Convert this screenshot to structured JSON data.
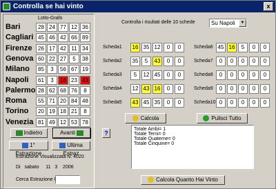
{
  "window": {
    "title": "Controlla se hai vinto",
    "close": "x"
  },
  "lotto": {
    "header": "Lotto-Grafo",
    "rows": [
      {
        "name": "Bari",
        "nums": [
          "28",
          "24",
          "77",
          "12",
          "36"
        ],
        "red": [
          false,
          false,
          false,
          false,
          false
        ]
      },
      {
        "name": "Cagliari",
        "nums": [
          "45",
          "46",
          "42",
          "66",
          "89"
        ],
        "red": [
          false,
          false,
          false,
          false,
          false
        ]
      },
      {
        "name": "Firenze",
        "nums": [
          "26",
          "17",
          "42",
          "11",
          "34"
        ],
        "red": [
          false,
          false,
          false,
          false,
          false
        ]
      },
      {
        "name": "Genova",
        "nums": [
          "60",
          "22",
          "27",
          "5",
          "38"
        ],
        "red": [
          false,
          false,
          false,
          false,
          false
        ]
      },
      {
        "name": "Milano",
        "nums": [
          "85",
          "3",
          "56",
          "67",
          "19"
        ],
        "red": [
          false,
          false,
          false,
          false,
          false
        ]
      },
      {
        "name": "Napoli",
        "nums": [
          "61",
          "3",
          "16",
          "23",
          "43"
        ],
        "red": [
          false,
          false,
          true,
          false,
          true
        ]
      },
      {
        "name": "Palermo",
        "nums": [
          "28",
          "62",
          "68",
          "76",
          "8"
        ],
        "red": [
          false,
          false,
          false,
          false,
          false
        ]
      },
      {
        "name": "Roma",
        "nums": [
          "55",
          "71",
          "20",
          "84",
          "48"
        ],
        "red": [
          false,
          false,
          false,
          false,
          false
        ]
      },
      {
        "name": "Torino",
        "nums": [
          "20",
          "19",
          "18",
          "21",
          "8"
        ],
        "red": [
          false,
          false,
          false,
          false,
          false
        ]
      },
      {
        "name": "Venezia",
        "nums": [
          "81",
          "49",
          "12",
          "53",
          "78"
        ],
        "red": [
          false,
          false,
          false,
          false,
          false
        ]
      }
    ]
  },
  "nav": {
    "prev": "Indietro",
    "next": "Avanti",
    "first": "1° Estrazione",
    "last": "Ultima Estraz"
  },
  "estrazione": {
    "label": "Estrazione Visualizzata N:",
    "number": "4020",
    "di": "Di",
    "day": "sabato",
    "d": "11",
    "m": "3",
    "y": "2006",
    "search_label": "Cerca Estrazione N:",
    "search_value": ""
  },
  "control": {
    "label": "Controlla i risultati delle 10 schede",
    "selected": "Su Napoli"
  },
  "schede": [
    {
      "label": "Scheda1",
      "nums": [
        "16",
        "35",
        "12",
        "0",
        "0"
      ],
      "hit": [
        true,
        false,
        false,
        false,
        false
      ]
    },
    {
      "label": "Scheda2",
      "nums": [
        "35",
        "5",
        "43",
        "0",
        "0"
      ],
      "hit": [
        false,
        false,
        true,
        false,
        false
      ]
    },
    {
      "label": "Scheda3",
      "nums": [
        "5",
        "12",
        "45",
        "0",
        "0"
      ],
      "hit": [
        false,
        false,
        false,
        false,
        false
      ]
    },
    {
      "label": "Scheda4",
      "nums": [
        "12",
        "43",
        "16",
        "0",
        "0"
      ],
      "hit": [
        false,
        true,
        true,
        false,
        false
      ]
    },
    {
      "label": "Scheda5",
      "nums": [
        "43",
        "45",
        "35",
        "0",
        "0"
      ],
      "hit": [
        true,
        false,
        false,
        false,
        false
      ]
    },
    {
      "label": "Scheda6",
      "nums": [
        "45",
        "16",
        "5",
        "0",
        "0"
      ],
      "hit": [
        false,
        true,
        false,
        false,
        false
      ]
    },
    {
      "label": "Scheda7",
      "nums": [
        "0",
        "0",
        "0",
        "0",
        "0"
      ],
      "hit": [
        false,
        false,
        false,
        false,
        false
      ]
    },
    {
      "label": "Scheda8",
      "nums": [
        "0",
        "0",
        "0",
        "0",
        "0"
      ],
      "hit": [
        false,
        false,
        false,
        false,
        false
      ]
    },
    {
      "label": "Scheda9",
      "nums": [
        "0",
        "0",
        "0",
        "0",
        "0"
      ],
      "hit": [
        false,
        false,
        false,
        false,
        false
      ]
    },
    {
      "label": "Scheda10",
      "nums": [
        "0",
        "0",
        "0",
        "0",
        "0"
      ],
      "hit": [
        false,
        false,
        false,
        false,
        false
      ]
    }
  ],
  "actions": {
    "calcola": "Calcola",
    "pulisci": "Pulisci Tutto",
    "calcola_vinto": "Calcola Quanto Hai Vinto",
    "help": "?"
  },
  "results": [
    "Totale Ambi= 1",
    "Totale Terni= 0",
    "Totale Quaterne= 0",
    "Totale Cinquine= 0"
  ]
}
